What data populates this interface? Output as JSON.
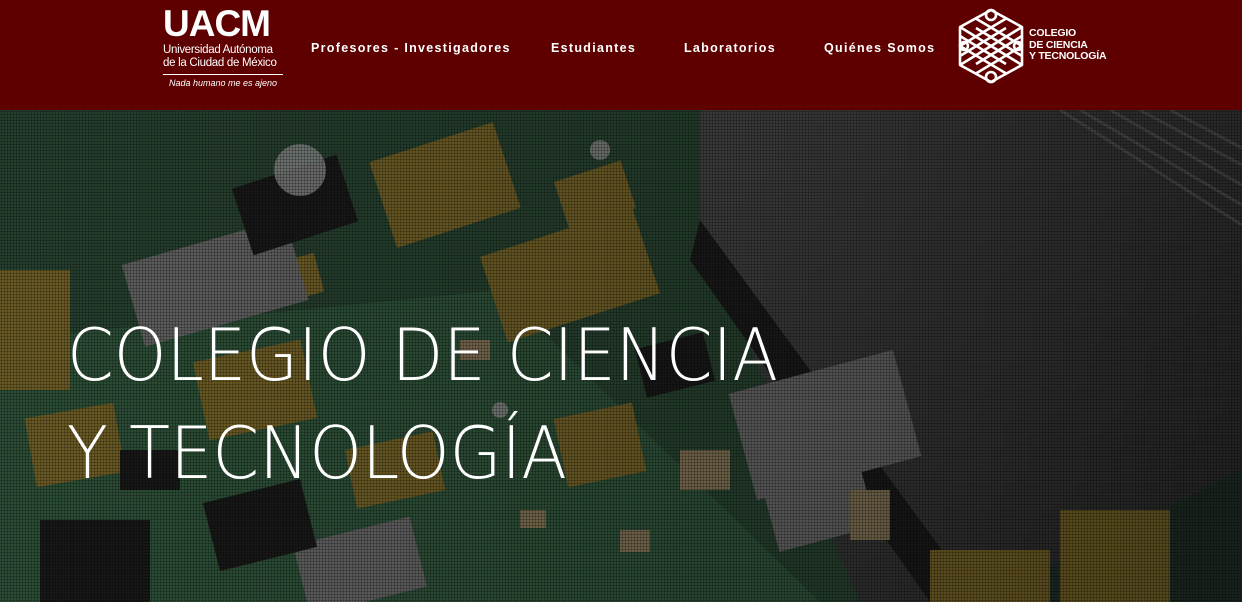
{
  "header": {
    "background_color": "#5e0000",
    "uacm_logo": {
      "mark": "UACM",
      "name_line1": "Universidad Autónoma",
      "name_line2": "de la Ciudad de México",
      "motto": "Nada humano me es ajeno"
    },
    "nav": [
      {
        "label": "Profesores - Investigadores"
      },
      {
        "label": "Estudiantes"
      },
      {
        "label": "Laboratorios"
      },
      {
        "label": "Quiénes Somos"
      }
    ],
    "college_logo": {
      "icon": "knotwork-hexagon-icon",
      "line1": "COLEGIO",
      "line2": "DE CIENCIA",
      "line3": "Y TECNOLOGÍA"
    }
  },
  "hero": {
    "title_line1": "COLEGIO DE CIENCIA",
    "title_line2": "Y TECNOLOGÍA",
    "background": "circuit-board-photo"
  }
}
